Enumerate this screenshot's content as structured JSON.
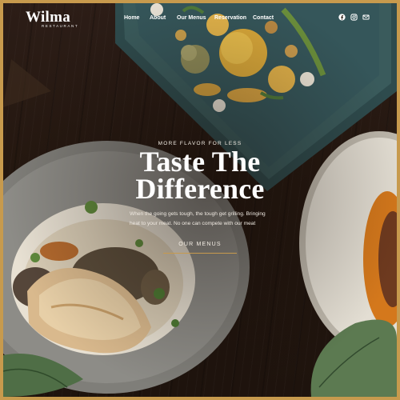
{
  "brand": {
    "name": "Wilma",
    "subtitle": "RESTAURANT"
  },
  "nav": {
    "items": [
      {
        "label": "Home",
        "active": true
      },
      {
        "label": "About"
      },
      {
        "label": "Our Menus"
      },
      {
        "label": "Reservation"
      },
      {
        "label": "Contact"
      }
    ]
  },
  "social": {
    "icons": [
      "facebook-icon",
      "instagram-icon",
      "email-icon"
    ]
  },
  "hero": {
    "eyebrow": "MORE FLAVOR FOR LESS",
    "headline_line1": "Taste The",
    "headline_line2": "Difference",
    "description": "When the going gets tough, the tough get grilling. Bringing heat to your meat. No one can compete with our meat",
    "cta_label": "OUR MENUS"
  },
  "colors": {
    "accent": "#c79a4d",
    "text": "#ffffff",
    "background": "#24170f"
  }
}
